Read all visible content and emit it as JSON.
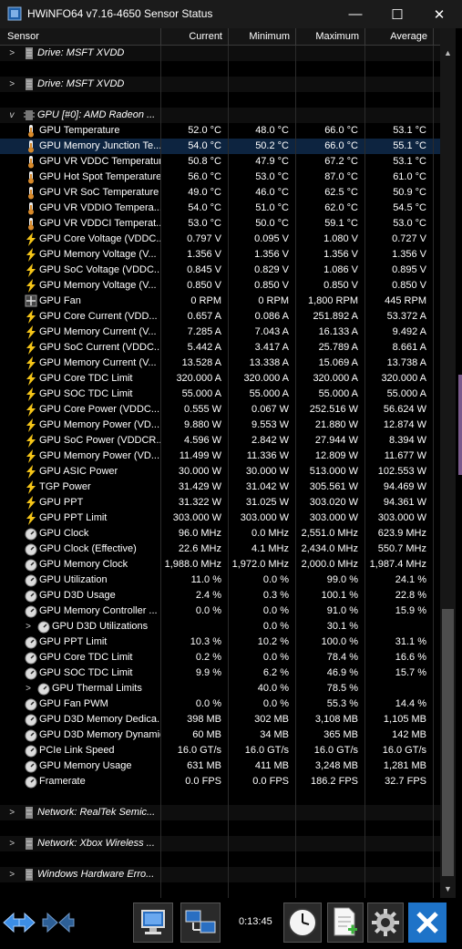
{
  "window": {
    "title": "HWiNFO64 v7.16-4650 Sensor Status",
    "minimize_glyph": "—",
    "maximize_glyph": "☐",
    "close_glyph": "✕"
  },
  "columns": {
    "sensor": "Sensor",
    "current": "Current",
    "minimum": "Minimum",
    "maximum": "Maximum",
    "average": "Average"
  },
  "rows": [
    {
      "type": "group",
      "expander": ">",
      "icon": "drive-icon",
      "label": "Drive: MSFT XVDD"
    },
    {
      "type": "blank"
    },
    {
      "type": "group",
      "expander": ">",
      "icon": "drive-icon",
      "label": "Drive: MSFT XVDD"
    },
    {
      "type": "blank"
    },
    {
      "type": "group",
      "expander": "v",
      "icon": "chip-icon",
      "label": "GPU [#0]: AMD Radeon ..."
    },
    {
      "type": "sensor",
      "icon": "thermometer-icon",
      "label": "GPU Temperature",
      "current": "52.0 °C",
      "minimum": "48.0 °C",
      "maximum": "66.0 °C",
      "average": "53.1 °C"
    },
    {
      "type": "sensor",
      "icon": "thermometer-icon",
      "label": "GPU Memory Junction Te...",
      "current": "54.0 °C",
      "minimum": "50.2 °C",
      "maximum": "66.0 °C",
      "average": "55.1 °C",
      "selected": true
    },
    {
      "type": "sensor",
      "icon": "thermometer-icon",
      "label": "GPU VR VDDC Temperature",
      "current": "50.8 °C",
      "minimum": "47.9 °C",
      "maximum": "67.2 °C",
      "average": "53.1 °C"
    },
    {
      "type": "sensor",
      "icon": "thermometer-icon",
      "label": "GPU Hot Spot Temperature",
      "current": "56.0 °C",
      "minimum": "53.0 °C",
      "maximum": "87.0 °C",
      "average": "61.0 °C"
    },
    {
      "type": "sensor",
      "icon": "thermometer-icon",
      "label": "GPU VR SoC Temperature",
      "current": "49.0 °C",
      "minimum": "46.0 °C",
      "maximum": "62.5 °C",
      "average": "50.9 °C"
    },
    {
      "type": "sensor",
      "icon": "thermometer-icon",
      "label": "GPU VR VDDIO Tempera...",
      "current": "54.0 °C",
      "minimum": "51.0 °C",
      "maximum": "62.0 °C",
      "average": "54.5 °C"
    },
    {
      "type": "sensor",
      "icon": "thermometer-icon",
      "label": "GPU VR VDDCI Temperat...",
      "current": "53.0 °C",
      "minimum": "50.0 °C",
      "maximum": "59.1 °C",
      "average": "53.0 °C"
    },
    {
      "type": "sensor",
      "icon": "lightning-icon",
      "label": "GPU Core Voltage (VDDC...",
      "current": "0.797 V",
      "minimum": "0.095 V",
      "maximum": "1.080 V",
      "average": "0.727 V"
    },
    {
      "type": "sensor",
      "icon": "lightning-icon",
      "label": "GPU Memory Voltage (V...",
      "current": "1.356 V",
      "minimum": "1.356 V",
      "maximum": "1.356 V",
      "average": "1.356 V"
    },
    {
      "type": "sensor",
      "icon": "lightning-icon",
      "label": "GPU SoC Voltage (VDDC...",
      "current": "0.845 V",
      "minimum": "0.829 V",
      "maximum": "1.086 V",
      "average": "0.895 V"
    },
    {
      "type": "sensor",
      "icon": "lightning-icon",
      "label": "GPU Memory Voltage (V...",
      "current": "0.850 V",
      "minimum": "0.850 V",
      "maximum": "0.850 V",
      "average": "0.850 V"
    },
    {
      "type": "sensor",
      "icon": "fan-icon",
      "label": "GPU Fan",
      "current": "0 RPM",
      "minimum": "0 RPM",
      "maximum": "1,800 RPM",
      "average": "445 RPM"
    },
    {
      "type": "sensor",
      "icon": "lightning-icon",
      "label": "GPU Core Current (VDD...",
      "current": "0.657 A",
      "minimum": "0.086 A",
      "maximum": "251.892 A",
      "average": "53.372 A"
    },
    {
      "type": "sensor",
      "icon": "lightning-icon",
      "label": "GPU Memory Current (V...",
      "current": "7.285 A",
      "minimum": "7.043 A",
      "maximum": "16.133 A",
      "average": "9.492 A"
    },
    {
      "type": "sensor",
      "icon": "lightning-icon",
      "label": "GPU SoC Current (VDDC...",
      "current": "5.442 A",
      "minimum": "3.417 A",
      "maximum": "25.789 A",
      "average": "8.661 A"
    },
    {
      "type": "sensor",
      "icon": "lightning-icon",
      "label": "GPU Memory Current (V...",
      "current": "13.528 A",
      "minimum": "13.338 A",
      "maximum": "15.069 A",
      "average": "13.738 A"
    },
    {
      "type": "sensor",
      "icon": "lightning-icon",
      "label": "GPU Core TDC Limit",
      "current": "320.000 A",
      "minimum": "320.000 A",
      "maximum": "320.000 A",
      "average": "320.000 A"
    },
    {
      "type": "sensor",
      "icon": "lightning-icon",
      "label": "GPU SOC TDC Limit",
      "current": "55.000 A",
      "minimum": "55.000 A",
      "maximum": "55.000 A",
      "average": "55.000 A"
    },
    {
      "type": "sensor",
      "icon": "lightning-icon",
      "label": "GPU Core Power (VDDC...",
      "current": "0.555 W",
      "minimum": "0.067 W",
      "maximum": "252.516 W",
      "average": "56.624 W"
    },
    {
      "type": "sensor",
      "icon": "lightning-icon",
      "label": "GPU Memory Power (VD...",
      "current": "9.880 W",
      "minimum": "9.553 W",
      "maximum": "21.880 W",
      "average": "12.874 W"
    },
    {
      "type": "sensor",
      "icon": "lightning-icon",
      "label": "GPU SoC Power (VDDCR...",
      "current": "4.596 W",
      "minimum": "2.842 W",
      "maximum": "27.944 W",
      "average": "8.394 W"
    },
    {
      "type": "sensor",
      "icon": "lightning-icon",
      "label": "GPU Memory Power (VD...",
      "current": "11.499 W",
      "minimum": "11.336 W",
      "maximum": "12.809 W",
      "average": "11.677 W"
    },
    {
      "type": "sensor",
      "icon": "lightning-icon",
      "label": "GPU ASIC Power",
      "current": "30.000 W",
      "minimum": "30.000 W",
      "maximum": "513.000 W",
      "average": "102.553 W"
    },
    {
      "type": "sensor",
      "icon": "lightning-icon",
      "label": "TGP Power",
      "current": "31.429 W",
      "minimum": "31.042 W",
      "maximum": "305.561 W",
      "average": "94.469 W"
    },
    {
      "type": "sensor",
      "icon": "lightning-icon",
      "label": "GPU PPT",
      "current": "31.322 W",
      "minimum": "31.025 W",
      "maximum": "303.020 W",
      "average": "94.361 W"
    },
    {
      "type": "sensor",
      "icon": "lightning-icon",
      "label": "GPU PPT Limit",
      "current": "303.000 W",
      "minimum": "303.000 W",
      "maximum": "303.000 W",
      "average": "303.000 W"
    },
    {
      "type": "sensor",
      "icon": "gauge-icon",
      "label": "GPU Clock",
      "current": "96.0 MHz",
      "minimum": "0.0 MHz",
      "maximum": "2,551.0 MHz",
      "average": "623.9 MHz"
    },
    {
      "type": "sensor",
      "icon": "gauge-icon",
      "label": "GPU Clock (Effective)",
      "current": "22.6 MHz",
      "minimum": "4.1 MHz",
      "maximum": "2,434.0 MHz",
      "average": "550.7 MHz"
    },
    {
      "type": "sensor",
      "icon": "gauge-icon",
      "label": "GPU Memory Clock",
      "current": "1,988.0 MHz",
      "minimum": "1,972.0 MHz",
      "maximum": "2,000.0 MHz",
      "average": "1,987.4 MHz"
    },
    {
      "type": "sensor",
      "icon": "gauge-icon",
      "label": "GPU Utilization",
      "current": "11.0 %",
      "minimum": "0.0 %",
      "maximum": "99.0 %",
      "average": "24.1 %"
    },
    {
      "type": "sensor",
      "icon": "gauge-icon",
      "label": "GPU D3D Usage",
      "current": "2.4 %",
      "minimum": "0.3 %",
      "maximum": "100.1 %",
      "average": "22.8 %"
    },
    {
      "type": "sensor",
      "icon": "gauge-icon",
      "label": "GPU Memory Controller ...",
      "current": "0.0 %",
      "minimum": "0.0 %",
      "maximum": "91.0 %",
      "average": "15.9 %"
    },
    {
      "type": "subgroup",
      "expander": ">",
      "icon": "gauge-icon",
      "label": "GPU D3D Utilizations",
      "current": "",
      "minimum": "0.0 %",
      "maximum": "30.1 %",
      "average": ""
    },
    {
      "type": "sensor",
      "icon": "gauge-icon",
      "label": "GPU PPT Limit",
      "current": "10.3 %",
      "minimum": "10.2 %",
      "maximum": "100.0 %",
      "average": "31.1 %"
    },
    {
      "type": "sensor",
      "icon": "gauge-icon",
      "label": "GPU Core TDC Limit",
      "current": "0.2 %",
      "minimum": "0.0 %",
      "maximum": "78.4 %",
      "average": "16.6 %"
    },
    {
      "type": "sensor",
      "icon": "gauge-icon",
      "label": "GPU SOC TDC Limit",
      "current": "9.9 %",
      "minimum": "6.2 %",
      "maximum": "46.9 %",
      "average": "15.7 %"
    },
    {
      "type": "subgroup",
      "expander": ">",
      "icon": "gauge-icon",
      "label": "GPU Thermal Limits",
      "current": "",
      "minimum": "40.0 %",
      "maximum": "78.5 %",
      "average": ""
    },
    {
      "type": "sensor",
      "icon": "gauge-icon",
      "label": "GPU Fan PWM",
      "current": "0.0 %",
      "minimum": "0.0 %",
      "maximum": "55.3 %",
      "average": "14.4 %"
    },
    {
      "type": "sensor",
      "icon": "gauge-icon",
      "label": "GPU D3D Memory Dedica...",
      "current": "398 MB",
      "minimum": "302 MB",
      "maximum": "3,108 MB",
      "average": "1,105 MB"
    },
    {
      "type": "sensor",
      "icon": "gauge-icon",
      "label": "GPU D3D Memory Dynamic",
      "current": "60 MB",
      "minimum": "34 MB",
      "maximum": "365 MB",
      "average": "142 MB"
    },
    {
      "type": "sensor",
      "icon": "gauge-icon",
      "label": "PCIe Link Speed",
      "current": "16.0 GT/s",
      "minimum": "16.0 GT/s",
      "maximum": "16.0 GT/s",
      "average": "16.0 GT/s"
    },
    {
      "type": "sensor",
      "icon": "gauge-icon",
      "label": "GPU Memory Usage",
      "current": "631 MB",
      "minimum": "411 MB",
      "maximum": "3,248 MB",
      "average": "1,281 MB"
    },
    {
      "type": "sensor",
      "icon": "gauge-icon",
      "label": "Framerate",
      "current": "0.0 FPS",
      "minimum": "0.0 FPS",
      "maximum": "186.2 FPS",
      "average": "32.7 FPS"
    },
    {
      "type": "blank"
    },
    {
      "type": "group",
      "expander": ">",
      "icon": "network-icon",
      "label": "Network: RealTek Semic..."
    },
    {
      "type": "blank"
    },
    {
      "type": "group",
      "expander": ">",
      "icon": "network-icon",
      "label": "Network: Xbox Wireless ..."
    },
    {
      "type": "blank"
    },
    {
      "type": "group",
      "expander": ">",
      "icon": "drive-icon",
      "label": "Windows Hardware Erro..."
    },
    {
      "type": "blank"
    }
  ],
  "toolbar": {
    "elapsed_time": "0:13:45",
    "buttons": [
      {
        "name": "expand-arrows-button",
        "icon": "left-right-arrows-icon"
      },
      {
        "name": "collapse-arrows-button",
        "icon": "collapse-arrows-icon"
      },
      {
        "name": "monitor-button",
        "icon": "monitor-icon"
      },
      {
        "name": "network-computers-button",
        "icon": "network-computers-icon"
      },
      {
        "name": "reset-timer-button",
        "icon": "clock-icon"
      },
      {
        "name": "logging-button",
        "icon": "add-document-icon"
      },
      {
        "name": "settings-button",
        "icon": "gear-icon"
      },
      {
        "name": "close-sensors-button",
        "icon": "close-x-icon"
      }
    ]
  },
  "colors": {
    "background": "#000000",
    "selected_row": "#0d2440",
    "text": "#ffffff",
    "close_button_bg": "#1e73c8",
    "lightning": "#f5c518",
    "thermometer": "#d98a2a"
  }
}
